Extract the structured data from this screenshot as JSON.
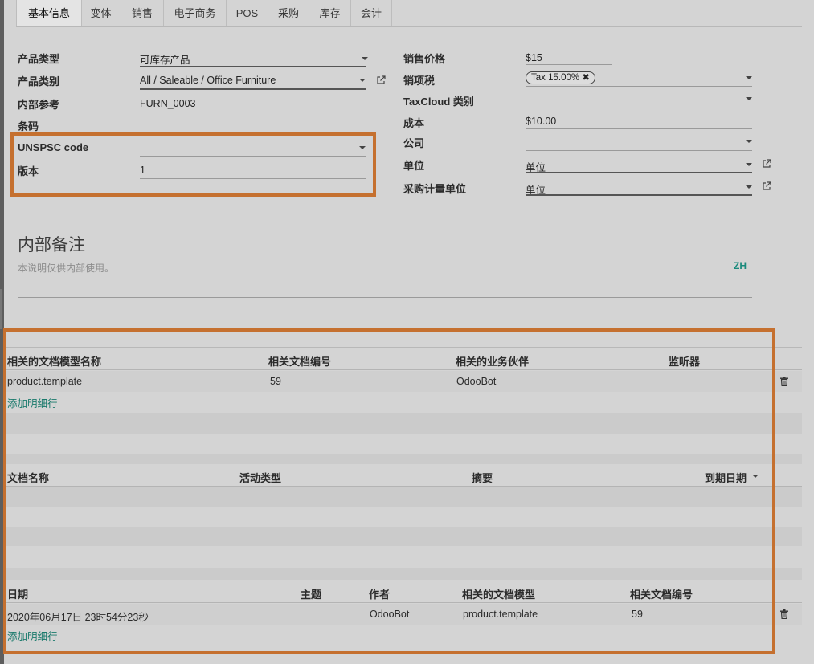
{
  "tabs": [
    "基本信息",
    "变体",
    "销售",
    "电子商务",
    "POS",
    "采购",
    "库存",
    "会计"
  ],
  "left_form": {
    "product_type": {
      "label": "产品类型",
      "value": "可库存产品"
    },
    "product_category": {
      "label": "产品类别",
      "value": "All / Saleable / Office Furniture"
    },
    "internal_ref": {
      "label": "内部参考",
      "value": "FURN_0003"
    },
    "barcode": {
      "label": "条码",
      "value": ""
    },
    "unspsc": {
      "label": "UNSPSC code",
      "value": ""
    },
    "version": {
      "label": "版本",
      "value": "1"
    }
  },
  "right_form": {
    "sale_price": {
      "label": "销售价格",
      "value": "$15"
    },
    "sale_tax": {
      "label": "销项税",
      "tag": "Tax 15.00%"
    },
    "taxcloud": {
      "label": "TaxCloud 类别",
      "value": ""
    },
    "cost": {
      "label": "成本",
      "value": "$10.00"
    },
    "company": {
      "label": "公司",
      "value": ""
    },
    "uom": {
      "label": "单位",
      "value": "单位"
    },
    "purchase_uom": {
      "label": "采购计量单位",
      "value": "单位"
    }
  },
  "internal_note": {
    "title": "内部备注",
    "placeholder": "本说明仅供内部使用。",
    "lang": "ZH"
  },
  "followers_table": {
    "headers": [
      "相关的文档模型名称",
      "相关文档编号",
      "相关的业务伙伴",
      "监听器"
    ],
    "rows": [
      [
        "product.template",
        "59",
        "OdooBot",
        ""
      ]
    ],
    "add_line": "添加明细行"
  },
  "activities_table": {
    "headers": [
      "文档名称",
      "活动类型",
      "摘要",
      "到期日期"
    ]
  },
  "messages_table": {
    "headers": [
      "日期",
      "主题",
      "作者",
      "相关的文档模型",
      "相关文档编号"
    ],
    "rows": [
      [
        "2020年06月17日 23时54分23秒",
        "",
        "OdooBot",
        "product.template",
        "59"
      ]
    ],
    "add_line": "添加明细行"
  },
  "icons": {
    "caret": "caret-down-icon",
    "external": "external-link-icon",
    "trash": "trash-icon",
    "remove": "remove-tag-icon"
  },
  "colors": {
    "highlight": "#c5702f",
    "link": "#1a7a6c"
  }
}
